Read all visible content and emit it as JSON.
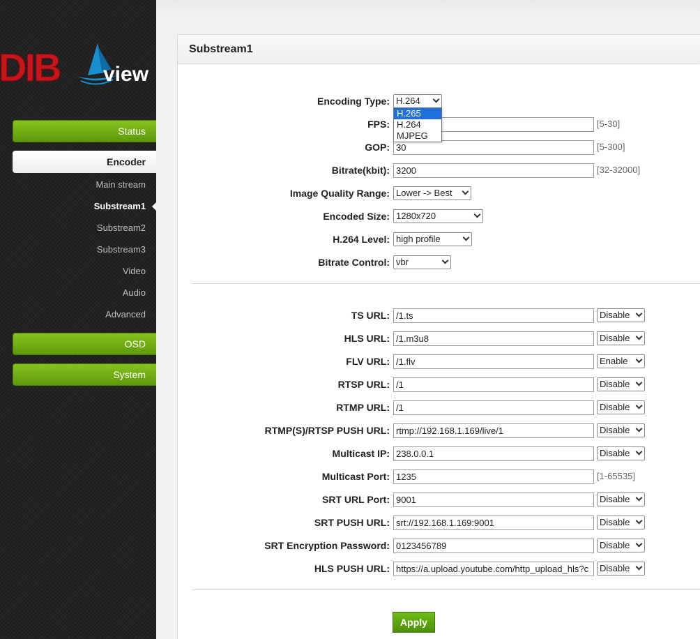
{
  "brand": {
    "logo_main": "DIB",
    "logo_sub": "view",
    "colors": {
      "red": "#c8151b",
      "blue": "#1a8fcf"
    }
  },
  "sidebar": {
    "items": [
      {
        "label": "Status"
      },
      {
        "label": "Encoder"
      },
      {
        "label": "OSD"
      },
      {
        "label": "System"
      }
    ],
    "sub_items": [
      {
        "label": "Main stream"
      },
      {
        "label": "Substream1"
      },
      {
        "label": "Substream2"
      },
      {
        "label": "Substream3"
      },
      {
        "label": "Video"
      },
      {
        "label": "Audio"
      },
      {
        "label": "Advanced"
      }
    ],
    "active_sub": "Substream1"
  },
  "panel": {
    "title": "Substream1"
  },
  "encoding": {
    "encoding_type": {
      "label": "Encoding Type:",
      "value": "H.264",
      "options": [
        "H.265",
        "H.264",
        "MJPEG"
      ],
      "highlighted": "H.265"
    },
    "fps": {
      "label": "FPS:",
      "value": "",
      "hint": "[5-30]"
    },
    "gop": {
      "label": "GOP:",
      "value": "30",
      "hint": "[5-300]"
    },
    "bitrate": {
      "label": "Bitrate(kbit):",
      "value": "3200",
      "hint": "[32-32000]"
    },
    "quality": {
      "label": "Image Quality Range:",
      "value": "Lower -> Best"
    },
    "size": {
      "label": "Encoded Size:",
      "value": "1280x720"
    },
    "level": {
      "label": "H.264 Level:",
      "value": "high profile"
    },
    "control": {
      "label": "Bitrate Control:",
      "value": "vbr"
    }
  },
  "urls": [
    {
      "label": "TS URL:",
      "value": "/1.ts",
      "toggle": "Disable"
    },
    {
      "label": "HLS URL:",
      "value": "/1.m3u8",
      "toggle": "Disable"
    },
    {
      "label": "FLV URL:",
      "value": "/1.flv",
      "toggle": "Enable"
    },
    {
      "label": "RTSP URL:",
      "value": "/1",
      "toggle": "Disable"
    },
    {
      "label": "RTMP URL:",
      "value": "/1",
      "toggle": "Disable"
    },
    {
      "label": "RTMP(S)/RTSP PUSH URL:",
      "value": "rtmp://192.168.1.169/live/1",
      "toggle": "Disable"
    },
    {
      "label": "Multicast IP:",
      "value": "238.0.0.1",
      "toggle": "Disable"
    },
    {
      "label": "Multicast Port:",
      "value": "1235",
      "hint": "[1-65535]"
    },
    {
      "label": "SRT URL Port:",
      "value": "9001",
      "toggle": "Disable"
    },
    {
      "label": "SRT PUSH URL:",
      "value": "srt://192.168.1.169:9001",
      "toggle": "Disable"
    },
    {
      "label": "SRT Encryption Password:",
      "value": "0123456789",
      "toggle": "Disable"
    },
    {
      "label": "HLS PUSH URL:",
      "value": "https://a.upload.youtube.com/http_upload_hls?c",
      "toggle": "Disable"
    }
  ],
  "apply_label": "Apply"
}
